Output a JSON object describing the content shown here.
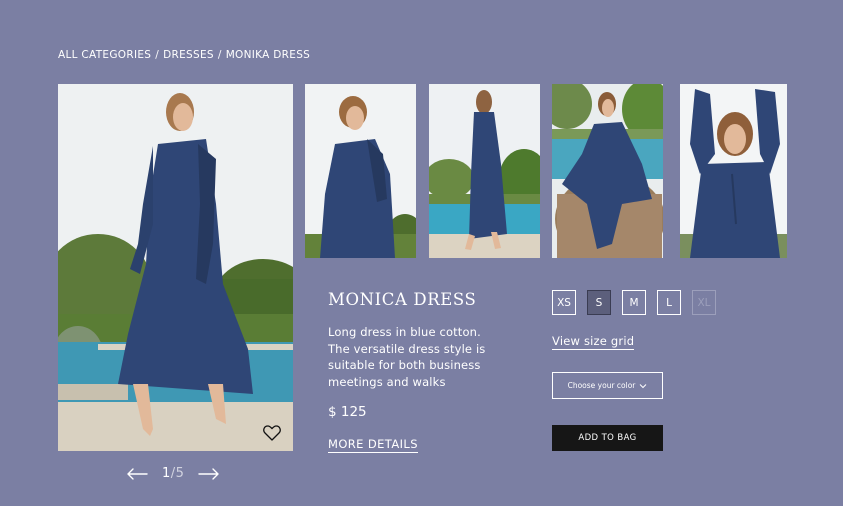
{
  "breadcrumb": {
    "items": [
      "ALL CATEGORIES",
      "DRESSES",
      "MONIKA DRESS"
    ],
    "separator": "/"
  },
  "gallery": {
    "current": "1",
    "separator": "/",
    "total": "5",
    "prev_icon": "arrow-left-icon",
    "next_icon": "arrow-right-icon",
    "favorite_icon": "heart-icon"
  },
  "product": {
    "title": "MONICA DRESS",
    "description": "Long dress in blue cotton. The versatile dress style is suitable for both business meetings and walks",
    "price": "$ 125",
    "more_details": "MORE DETAILS"
  },
  "sizes": [
    {
      "label": "XS",
      "state": "available"
    },
    {
      "label": "S",
      "state": "selected"
    },
    {
      "label": "M",
      "state": "available"
    },
    {
      "label": "L",
      "state": "available"
    },
    {
      "label": "XL",
      "state": "disabled"
    }
  ],
  "size_grid_link": "View size grid",
  "color_select": {
    "placeholder": "Choose your color",
    "icon": "chevron-down-icon"
  },
  "add_to_bag": "ADD TO BAG",
  "colors": {
    "background": "#7b7fa3",
    "dress": "#2f4676",
    "button": "#161616"
  }
}
